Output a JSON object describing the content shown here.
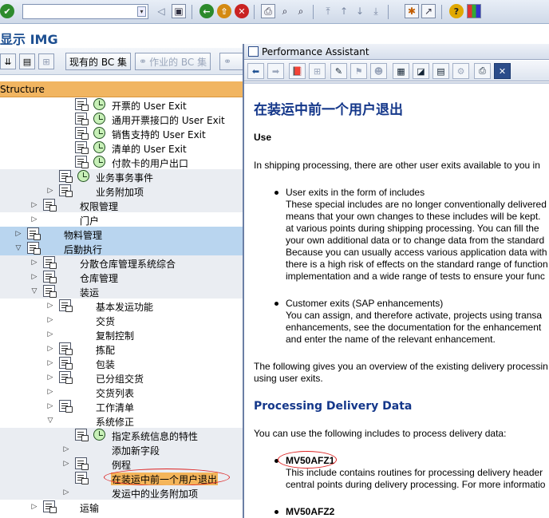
{
  "window": {
    "title": "显示 IMG",
    "command_field_value": ""
  },
  "app_toolbar": {
    "current_bc_sets": "现有的 BC 集",
    "activity_bc_sets": "作业的 BC 集"
  },
  "tree": {
    "header": "Structure",
    "rows": [
      {
        "label": "开票的 User Exit"
      },
      {
        "label": "通用开票接口的 User Exit"
      },
      {
        "label": "销售支持的 User Exit"
      },
      {
        "label": "清单的 User Exit"
      },
      {
        "label": "付款卡的用户出口"
      },
      {
        "label": "业务事务事件"
      },
      {
        "label": "业务附加项"
      },
      {
        "label": "权限管理"
      },
      {
        "label": "门户"
      },
      {
        "label": "物料管理"
      },
      {
        "label": "后勤执行"
      },
      {
        "label": "分散仓库管理系统综合"
      },
      {
        "label": "仓库管理"
      },
      {
        "label": "装运"
      },
      {
        "label": "基本发运功能"
      },
      {
        "label": "交货"
      },
      {
        "label": "复制控制"
      },
      {
        "label": "拣配"
      },
      {
        "label": "包装"
      },
      {
        "label": "已分组交货"
      },
      {
        "label": "交货列表"
      },
      {
        "label": "工作清单"
      },
      {
        "label": "系统修正"
      },
      {
        "label": "指定系统信息的特性"
      },
      {
        "label": "添加新字段"
      },
      {
        "label": "例程"
      },
      {
        "label": "在装运中前一个用户退出"
      },
      {
        "label": "发运中的业务附加项"
      },
      {
        "label": "运输"
      },
      {
        "label": "..."
      }
    ]
  },
  "assistant": {
    "title": "Performance Assistant",
    "heading": "在装运中前一个用户退出",
    "use_label": "Use",
    "intro": "In shipping processing, there are other user exits available to you in",
    "bullet1_title": "User exits in the form of includes",
    "bullet1_lines": [
      "These special includes are no longer conventionally delivered",
      "means that your own changes to these includes will be kept.",
      "at various points during shipping processing. You can fill the",
      "your own additional data or to change data from the standard",
      "Because you can usually access various application data with",
      "there is a high risk of effects on the standard range of function",
      "implementation and a wide range of tests to ensure your func"
    ],
    "bullet2_title": "Customer exits (SAP enhancements)",
    "bullet2_lines": [
      "You can assign, and therefore activate, projects using transa",
      "enhancements, see the documentation for the enhancement",
      "and enter the name of the relevant enhancement."
    ],
    "overview_lines": [
      "The following gives you an overview of the existing delivery processin",
      "using user exits."
    ],
    "section_heading": "Processing Delivery Data",
    "section_intro": "You can use the following includes to process delivery data:",
    "include1_name": "MV50AFZ1",
    "include1_lines": [
      "This include contains routines for processing delivery header",
      "central points during delivery processing. For more informatio"
    ],
    "include2_name": "MV50AFZ2"
  },
  "colors": {
    "title_blue": "#1d4f91",
    "heading_blue": "#14378a",
    "tree_header_orange": "#f1b561",
    "selected_row_blue": "#b9d5ef",
    "highlight_orange": "#f4b55a",
    "annotation_red": "#dd2222"
  }
}
